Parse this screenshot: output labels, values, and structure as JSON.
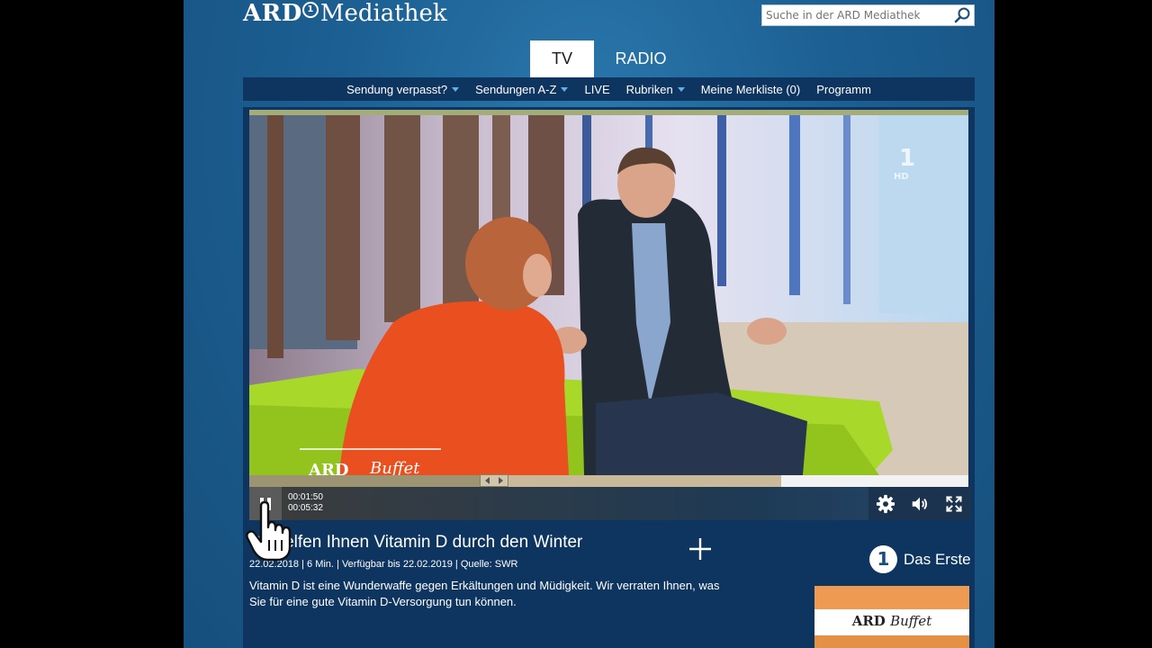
{
  "header": {
    "logo_primary": "ARD",
    "logo_symbol": "1",
    "logo_secondary": "Mediathek",
    "search_placeholder": "Suche in der ARD Mediathek"
  },
  "tabs": [
    {
      "label": "TV",
      "active": true
    },
    {
      "label": "RADIO",
      "active": false
    }
  ],
  "nav": [
    {
      "label": "Sendung verpasst?",
      "dropdown": true
    },
    {
      "label": "Sendungen A-Z",
      "dropdown": true
    },
    {
      "label": "LIVE",
      "dropdown": false
    },
    {
      "label": "Rubriken",
      "dropdown": true
    },
    {
      "label": "Meine Merkliste (0)",
      "dropdown": false
    },
    {
      "label": "Programm",
      "dropdown": false
    }
  ],
  "video": {
    "channel_bug": "HD",
    "overlay_logo_primary": "ARD",
    "overlay_logo_secondary": "Buffet"
  },
  "player": {
    "current_time": "00:01:50",
    "duration": "00:05:32",
    "played_fraction": 0.34,
    "buffered_fraction": 0.74
  },
  "episode": {
    "title": "So helfen Ihnen Vitamin D durch den Winter",
    "meta": "22.02.2018 | 6 Min. | Verfügbar bis 22.02.2019 | Quelle: SWR",
    "description": "Vitamin D ist eine Wunderwaffe gegen Erkältungen und Müdigkeit. Wir verraten Ihnen, was Sie für eine gute Vitamin D-Versorgung tun können."
  },
  "channel": {
    "symbol": "1",
    "name": "Das Erste"
  },
  "thumbnail": {
    "primary": "ARD",
    "secondary": "Buffet"
  },
  "colors": {
    "page_bg": "#1c5f92",
    "nav_bg": "#0e3560",
    "accent": "#5eb2e9"
  }
}
